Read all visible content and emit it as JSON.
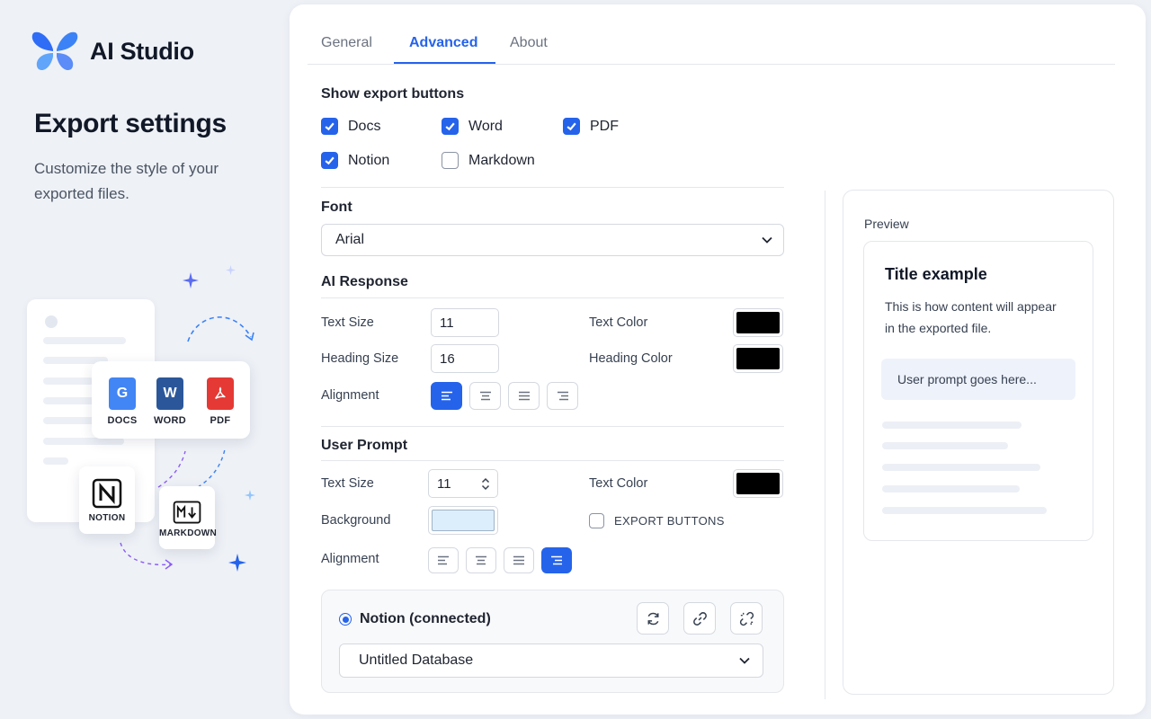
{
  "brand": {
    "name": "AI Studio",
    "logo_icon": "butterfly-logo"
  },
  "hero": {
    "title": "Export settings",
    "subtitle": "Customize the style of your exported files."
  },
  "illustration": {
    "formats": [
      "DOCS",
      "WORD",
      "PDF"
    ],
    "notion_label": "NOTION",
    "markdown_label": "MARKDOWN"
  },
  "tabs": [
    {
      "label": "General",
      "active": false
    },
    {
      "label": "Advanced",
      "active": true
    },
    {
      "label": "About",
      "active": false
    }
  ],
  "export_buttons": {
    "title": "Show export buttons",
    "options": [
      {
        "label": "Docs",
        "checked": true
      },
      {
        "label": "Word",
        "checked": true
      },
      {
        "label": "PDF",
        "checked": true
      },
      {
        "label": "Notion",
        "checked": true
      },
      {
        "label": "Markdown",
        "checked": false
      }
    ]
  },
  "font": {
    "title": "Font",
    "value": "Arial"
  },
  "ai_response": {
    "title": "AI Response",
    "text_size_label": "Text Size",
    "text_size": "11",
    "heading_size_label": "Heading Size",
    "heading_size": "16",
    "text_color_label": "Text Color",
    "text_color": "#000000",
    "heading_color_label": "Heading Color",
    "heading_color": "#000000",
    "alignment_label": "Alignment",
    "alignment": "left"
  },
  "user_prompt": {
    "title": "User Prompt",
    "text_size_label": "Text Size",
    "text_size": "11",
    "text_color_label": "Text Color",
    "text_color": "#000000",
    "background_label": "Background",
    "background_color": "#dceefb",
    "export_buttons_label": "EXPORT BUTTONS",
    "export_buttons_checked": false,
    "alignment_label": "Alignment",
    "alignment": "right"
  },
  "notion": {
    "status": "Notion (connected)",
    "database": "Untitled Database",
    "actions": [
      "refresh-icon",
      "link-icon",
      "unlink-icon"
    ]
  },
  "preview": {
    "label": "Preview",
    "title": "Title example",
    "body": "This is how content will appear in the exported file.",
    "prompt": "User prompt goes here..."
  },
  "colors": {
    "accent": "#2563eb",
    "background": "#eef1f6"
  }
}
